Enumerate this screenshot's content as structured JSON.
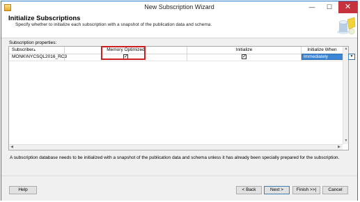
{
  "window": {
    "title": "New Subscription Wizard",
    "minimize_glyph": "—",
    "maximize_glyph": "☐",
    "close_glyph": "✕"
  },
  "header": {
    "title": "Initialize Subscriptions",
    "subtitle": "Specify whether to initialize each subscription with a snapshot of the publication data and schema."
  },
  "properties_label": "Subscription properties:",
  "table": {
    "columns": [
      "Subscriber",
      "Memory Optimized",
      "Initialize",
      "Initialize When"
    ],
    "rows": [
      {
        "subscriber": "MONK\\NYCSQL2016_RC3",
        "memory_optimized": true,
        "initialize": true,
        "initialize_when": "Immediately"
      }
    ],
    "check_glyph": "✓",
    "sort_glyph": "▲",
    "dropdown_glyph": "▼"
  },
  "note": "A subscription database needs to be initialized with a snapshot of the publication data and schema unless it has already been specially prepared for the subscription.",
  "buttons": {
    "help": "Help",
    "back": "< Back",
    "next": "Next >",
    "finish": "Finish >>|",
    "cancel": "Cancel"
  },
  "icons": {
    "app": "wizard-app-icon",
    "header": "database-wizard-graphic"
  },
  "colors": {
    "accent": "#3a86d4",
    "highlight_border": "#cc1f1f",
    "close_button": "#c7333c"
  }
}
